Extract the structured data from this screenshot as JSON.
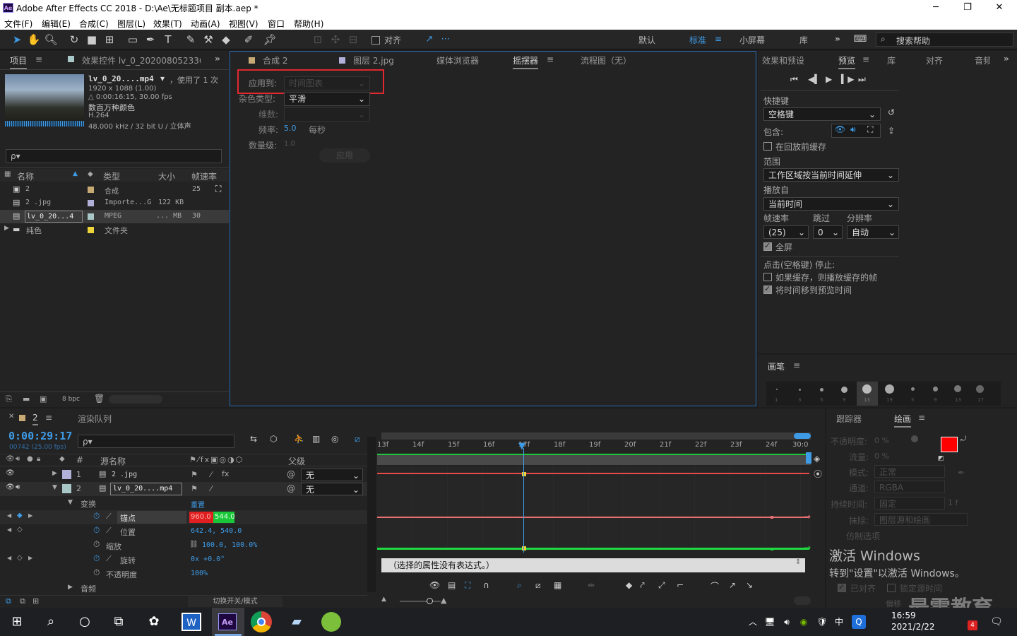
{
  "window": {
    "title": "Adobe After Effects CC 2018 - D:\\Ae\\无标题项目 副本.aep *",
    "logo": "Ae",
    "min": "─",
    "max": "❐",
    "close": "✕"
  },
  "menu": [
    "文件(F)",
    "编辑(E)",
    "合成(C)",
    "图层(L)",
    "效果(T)",
    "动画(A)",
    "视图(V)",
    "窗口",
    "帮助(H)"
  ],
  "toolbar": {
    "align_label": "对齐",
    "workspaces": [
      "默认",
      "标准",
      "小屏幕",
      "库"
    ],
    "active_workspace": "标准",
    "more": "»",
    "search_placeholder": "搜索帮助"
  },
  "project": {
    "tab_project": "项目",
    "tab_effects": "效果控件 lv_0_2020080523360€",
    "footage_name": "lv_0_20....mp4",
    "used": "，使用了 1 次",
    "dims": "1920 x 1088 (1.00)",
    "duration": "△ 0:00:16:15, 30.00 fps",
    "colors": "数百万种颜色",
    "codec": "H.264",
    "audio": "48.000 kHz / 32 bit U / 立体声",
    "search_placeholder": "ρ▾",
    "cols": [
      "名称",
      "类型",
      "大小",
      "帧速率"
    ],
    "rows": [
      {
        "name": "2",
        "type": "合成",
        "size": "",
        "fps": "25",
        "swatch": "#c8aa75"
      },
      {
        "name": "2 .jpg",
        "type": "Importe...G",
        "size": "122 KB",
        "fps": "",
        "swatch": "#b0b0d8"
      },
      {
        "name": "lv_0_20...4",
        "type": "MPEG",
        "size": "... MB",
        "fps": "30",
        "swatch": "#a8c8c8"
      },
      {
        "name": "纯色",
        "type": "文件夹",
        "size": "",
        "fps": "",
        "swatch": "#ecd43a"
      }
    ],
    "bpc": "8 bpc"
  },
  "center": {
    "tabs": [
      "合成 2",
      "图层 2.jpg",
      "媒体浏览器",
      "摇摆器",
      "流程图（无）"
    ],
    "active_tab": "摇摆器",
    "apply_to_label": "应用到:",
    "apply_to_value": "时间图表",
    "noise_label": "杂色类型:",
    "noise_value": "平滑",
    "dim_label": "维数:",
    "freq_label": "频率:",
    "freq_value": "5.0",
    "freq_unit": "每秒",
    "mag_label": "数量级:",
    "mag_value": "1.0",
    "apply_button": "应用"
  },
  "right": {
    "tabs": [
      "效果和预设",
      "预览",
      "库",
      "对齐",
      "音频"
    ],
    "active_tab": "预览",
    "shortcut_label": "快捷键",
    "shortcut_value": "空格键",
    "include_label": "包含:",
    "cache_label": "在回放前缓存",
    "range_label": "范围",
    "range_value": "工作区域按当前时间延伸",
    "playfrom_label": "播放自",
    "playfrom_value": "当前时间",
    "fps_label": "帧速率",
    "skip_label": "跳过",
    "res_label": "分辨率",
    "fps_value": "(25)",
    "skip_value": "0",
    "res_value": "自动",
    "fullscreen_label": "全屏",
    "stop_label": "点击(空格键) 停止:",
    "cache_play_label": "如果缓存，则播放缓存的帧",
    "move_time_label": "将时间移到预览时间",
    "brush_tab": "画笔",
    "brush_sizes": [
      "1",
      "3",
      "5",
      "9",
      "13",
      "19",
      "5",
      "9",
      "13",
      "17"
    ]
  },
  "timeline": {
    "comp_tab": "2",
    "render_tab": "渲染队列",
    "timecode": "0:00:29:17",
    "frames": "00742 (25.00 fps)",
    "search_placeholder": "ρ▾",
    "col_source": "源名称",
    "col_parent": "父级",
    "layers": [
      {
        "num": "1",
        "name": "2 .jpg",
        "parent": "无",
        "swatch": "#b0b0d8"
      },
      {
        "num": "2",
        "name": "lv_0_20....mp4",
        "parent": "无",
        "swatch": "#a8c8c8"
      }
    ],
    "transform_label": "变换",
    "reset_label": "重置",
    "props": [
      {
        "name": "锚点",
        "v1": "960.0",
        "v2": "544.0"
      },
      {
        "name": "位置",
        "value": "642.4, 540.0"
      },
      {
        "name": "缩放",
        "value": "100.0, 100.0%"
      },
      {
        "name": "旋转",
        "value": "0x +0.0°"
      },
      {
        "name": "不透明度",
        "value": "100%"
      }
    ],
    "audio_label": "音频",
    "switch_label": "切换开关/模式",
    "ruler": [
      "13f",
      "14f",
      "15f",
      "16f",
      "17f",
      "18f",
      "19f",
      "20f",
      "21f",
      "22f",
      "23f",
      "24f",
      "30:0"
    ],
    "expr_text": "（选择的属性没有表达式。）"
  },
  "tracker": {
    "tabs": [
      "跟踪器",
      "绘画"
    ],
    "active_tab": "绘画",
    "opacity_label": "不透明度:",
    "opacity_value": "0 %",
    "flow_label": "流量:",
    "flow_value": "0 %",
    "mode_label": "模式:",
    "mode_value": "正常",
    "channel_label": "通道:",
    "channel_value": "RGBA",
    "duration_label": "持续时间:",
    "duration_value": "固定",
    "duration_frames": "1 f",
    "erase_label": "抹除:",
    "erase_value": "图层源和绘画",
    "clone_label": "仿制选项",
    "aligned_label": "已对齐",
    "lock_label": "锁定源时间",
    "offset_label": "偏移"
  },
  "activate": {
    "line1": "激活 Windows",
    "line2": "转到\"设置\"以激活 Windows。"
  },
  "watermark": "最需教育",
  "taskbar": {
    "time": "16:59",
    "date": "2021/2/22",
    "ime": "中",
    "notify": "4"
  }
}
